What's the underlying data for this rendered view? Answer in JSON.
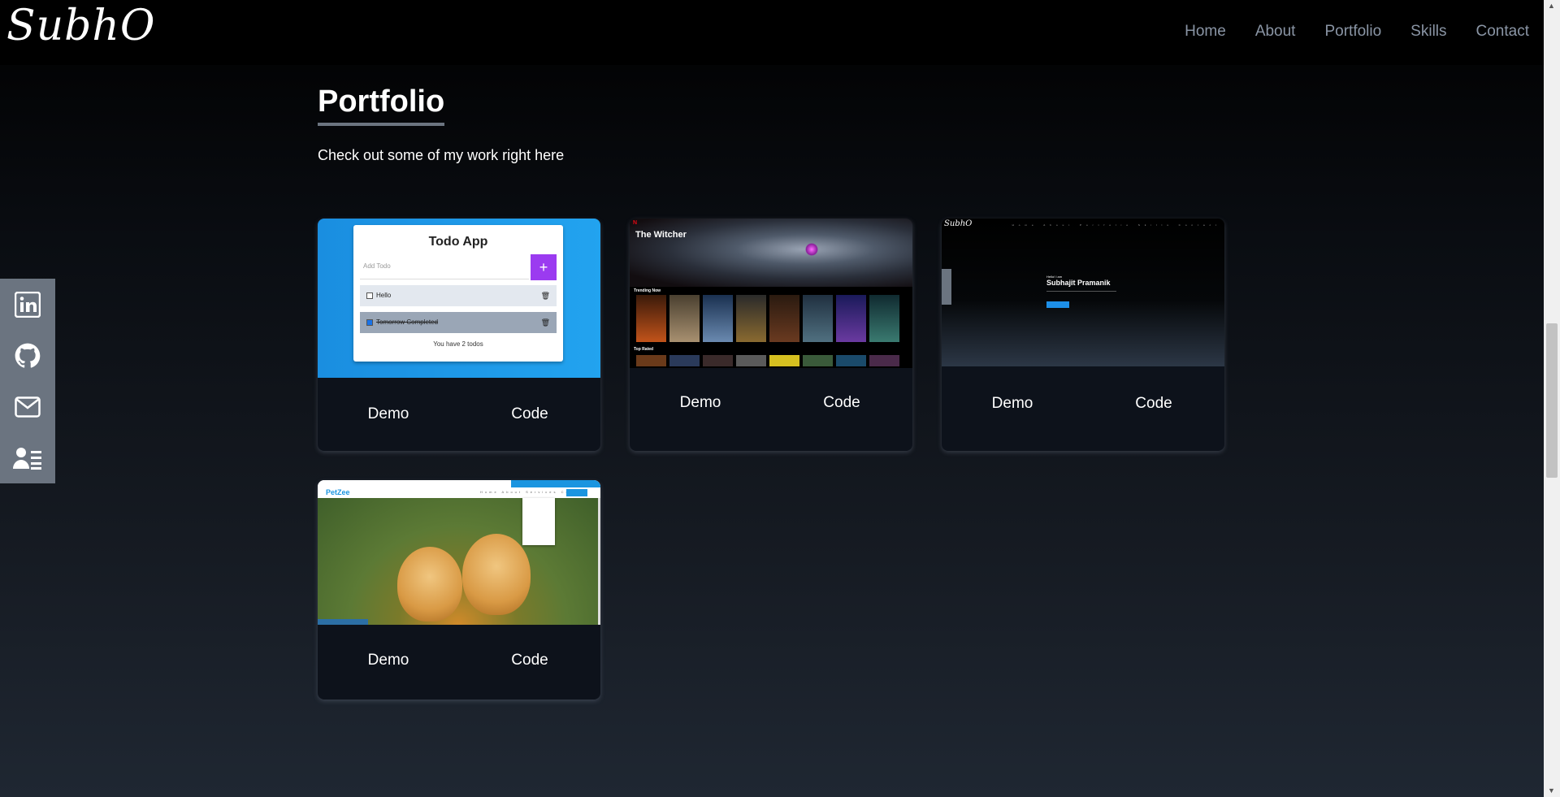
{
  "brand": {
    "logo": "SubhO"
  },
  "nav": {
    "items": [
      "Home",
      "About",
      "Portfolio",
      "Skills",
      "Contact"
    ]
  },
  "social": {
    "items": [
      "linkedin-icon",
      "github-icon",
      "mail-icon",
      "resume-icon"
    ]
  },
  "portfolio": {
    "title": "Portfolio",
    "subtitle": "Check out some of my work right here",
    "projects": [
      {
        "preview": {
          "title": "Todo App",
          "input_placeholder": "Add Todo",
          "items": [
            "Hello",
            "Tomorrow Completed"
          ],
          "count_text": "You have 2 todos"
        },
        "demo_label": "Demo",
        "code_label": "Code"
      },
      {
        "preview": {
          "title": "The Witcher",
          "rows": [
            "Trending Now",
            "Top Rated"
          ]
        },
        "demo_label": "Demo",
        "code_label": "Code"
      },
      {
        "preview": {
          "greeting": "Hello! I am",
          "name": "Subhajit Pramanik"
        },
        "demo_label": "Demo",
        "code_label": "Code"
      },
      {
        "preview": {
          "brand": "PetZee"
        },
        "demo_label": "Demo",
        "code_label": "Code"
      }
    ]
  },
  "colors": {
    "accent": "#6b7480",
    "todo_gradient": "#1a8ee0",
    "todo_add": "#9b3bf0",
    "petzee_blue": "#1b95e0"
  }
}
